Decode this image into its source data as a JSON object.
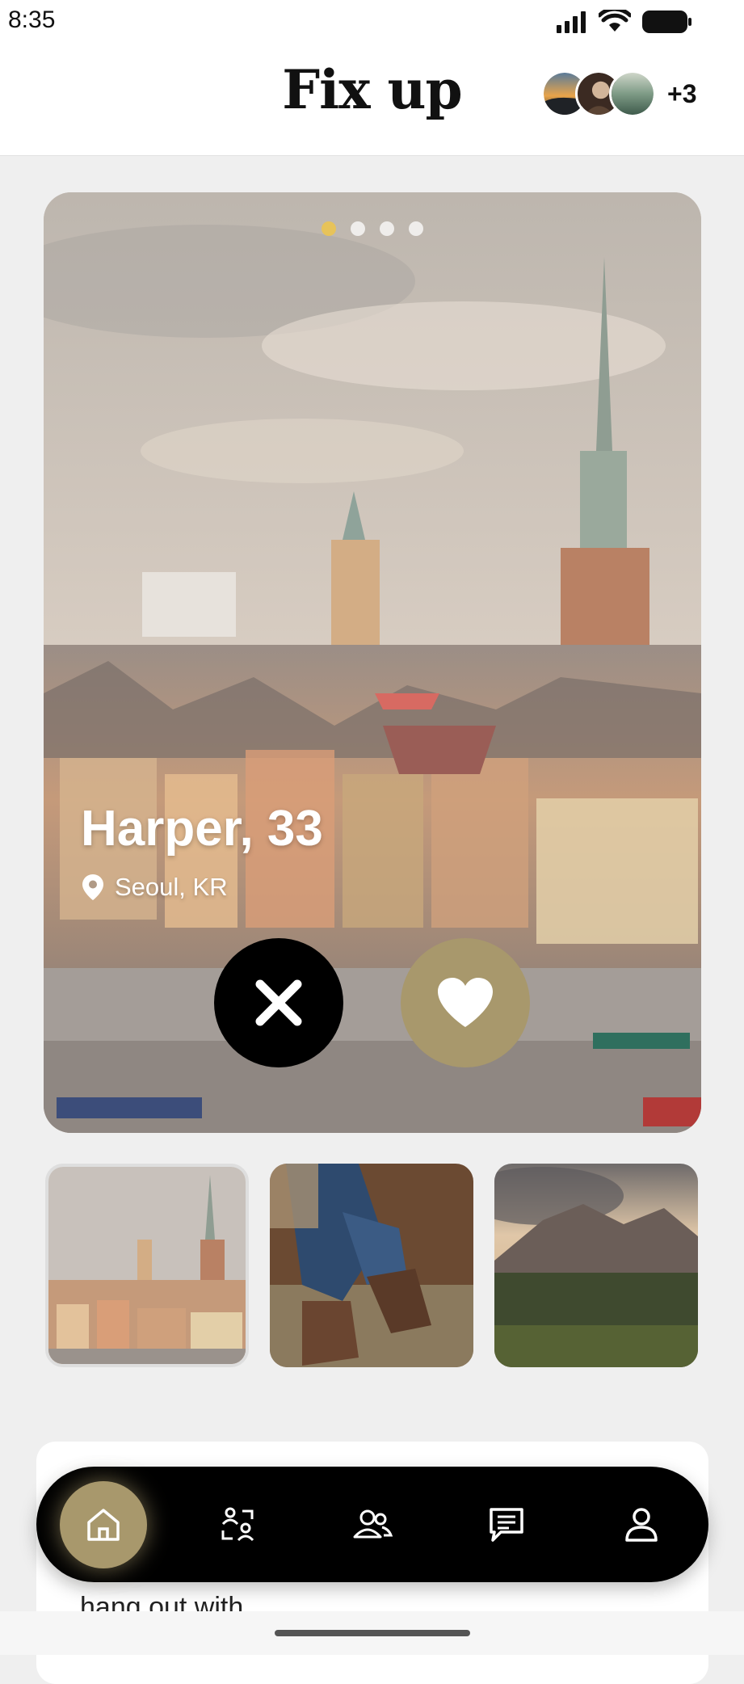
{
  "status_bar": {
    "time": "8:35",
    "icons": [
      "signal-icon",
      "wifi-icon",
      "battery-icon"
    ]
  },
  "header": {
    "title": "Fix up",
    "avatar_overflow": "+3"
  },
  "profile": {
    "name_age": "Harper, 33",
    "location": "Seoul, KR",
    "photo_count": 4,
    "active_photo_index": 0
  },
  "thumbnails": [
    {
      "subject": "city-skyline",
      "active": true
    },
    {
      "subject": "boots-and-jeans",
      "active": false
    },
    {
      "subject": "mountain-landscape",
      "active": false
    }
  ],
  "bio": {
    "partial_text": "hang out with"
  },
  "bottom_nav": {
    "items": [
      {
        "name": "home",
        "icon": "home-icon",
        "active": true
      },
      {
        "name": "matches",
        "icon": "people-swap-icon",
        "active": false
      },
      {
        "name": "friends",
        "icon": "group-icon",
        "active": false
      },
      {
        "name": "messages",
        "icon": "chat-icon",
        "active": false
      },
      {
        "name": "profile",
        "icon": "user-icon",
        "active": false
      }
    ]
  },
  "colors": {
    "accent": "#a8986c",
    "dot_active": "#e7c35a",
    "nav_background": "#000000"
  }
}
